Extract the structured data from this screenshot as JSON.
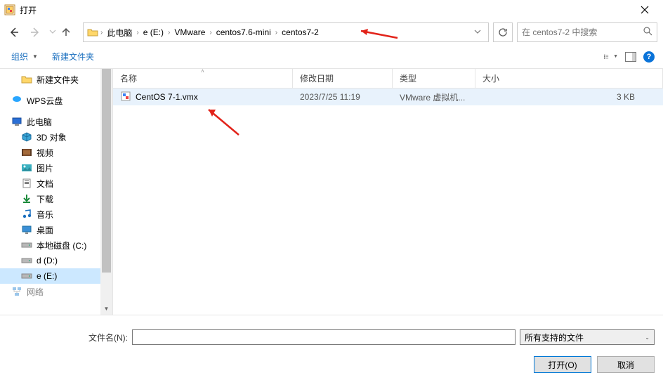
{
  "title": "打开",
  "breadcrumb": {
    "items": [
      "此电脑",
      "e (E:)",
      "VMware",
      "centos7.6-mini",
      "centos7-2"
    ]
  },
  "search": {
    "placeholder": "在 centos7-2 中搜索"
  },
  "toolbar": {
    "organize": "组织",
    "newfolder": "新建文件夹"
  },
  "columns": {
    "name": "名称",
    "date": "修改日期",
    "type": "类型",
    "size": "大小"
  },
  "sidebar": {
    "items": [
      {
        "icon": "folder",
        "label": "新建文件夹",
        "level": "l1"
      },
      {
        "icon": "spacer",
        "label": "",
        "level": "l0"
      },
      {
        "icon": "wps",
        "label": "WPS云盘",
        "level": "l0"
      },
      {
        "icon": "spacer",
        "label": "",
        "level": "l0"
      },
      {
        "icon": "thispc",
        "label": "此电脑",
        "level": "l0"
      },
      {
        "icon": "3d",
        "label": "3D 对象",
        "level": "l1"
      },
      {
        "icon": "video",
        "label": "视频",
        "level": "l1"
      },
      {
        "icon": "pictures",
        "label": "图片",
        "level": "l1"
      },
      {
        "icon": "docs",
        "label": "文档",
        "level": "l1"
      },
      {
        "icon": "downloads",
        "label": "下载",
        "level": "l1"
      },
      {
        "icon": "music",
        "label": "音乐",
        "level": "l1"
      },
      {
        "icon": "desktop",
        "label": "桌面",
        "level": "l1"
      },
      {
        "icon": "drive",
        "label": "本地磁盘 (C:)",
        "level": "l1"
      },
      {
        "icon": "drive",
        "label": "d (D:)",
        "level": "l1"
      },
      {
        "icon": "drive",
        "label": "e (E:)",
        "level": "l1",
        "selected": true
      },
      {
        "icon": "network",
        "label": "网络",
        "level": "l0",
        "cut": true
      }
    ]
  },
  "files": [
    {
      "name": "CentOS 7-1.vmx",
      "date": "2023/7/25 11:19",
      "type": "VMware 虚拟机...",
      "size": "3 KB"
    }
  ],
  "filenamebar": {
    "label": "文件名(N):",
    "filter": "所有支持的文件"
  },
  "buttons": {
    "open": "打开(O)",
    "cancel": "取消"
  }
}
